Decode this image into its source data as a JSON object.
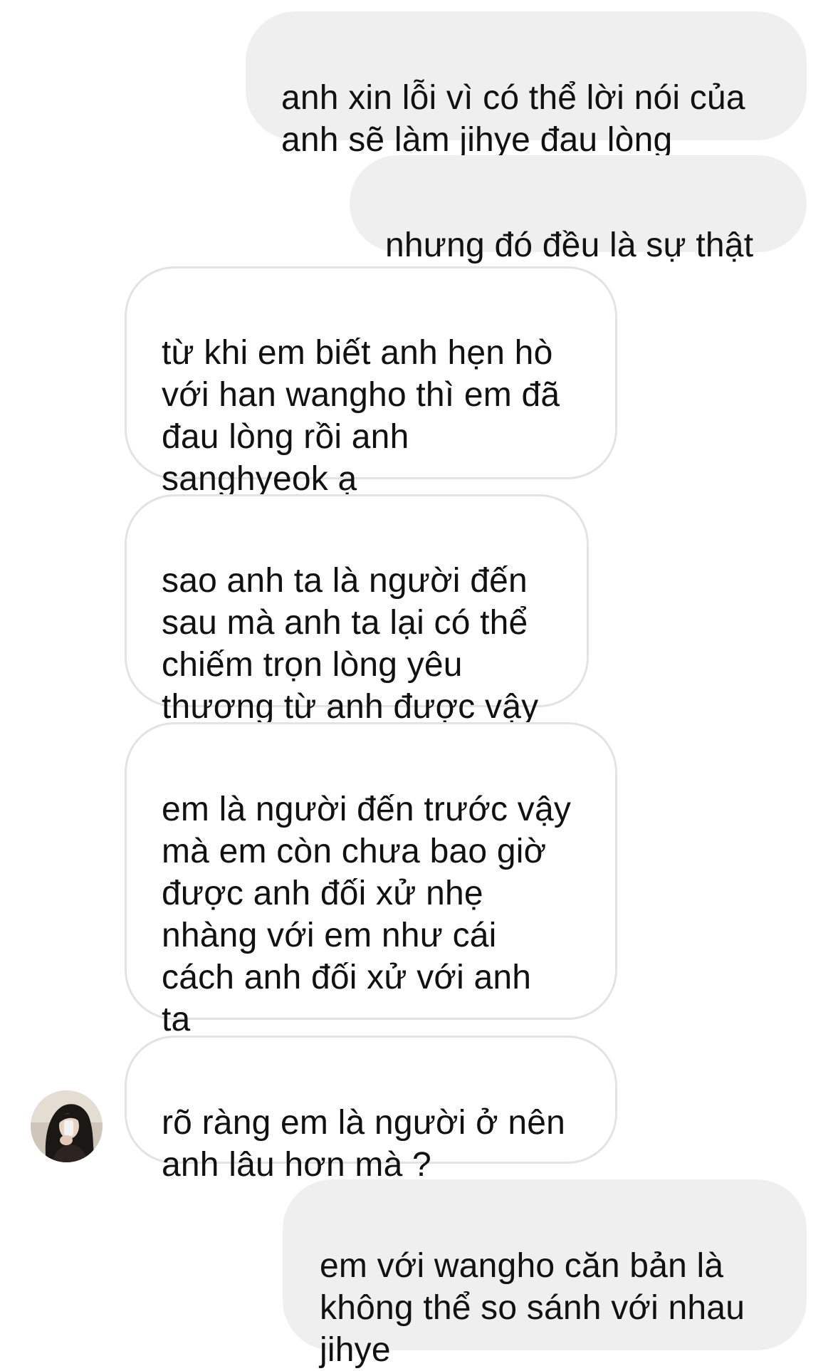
{
  "conversation": {
    "messages": [
      {
        "direction": "sent",
        "text": "anh xin lỗi vì có thể lời nói của\nanh sẽ làm jihye đau lòng"
      },
      {
        "direction": "sent",
        "text": "nhưng đó đều là sự thật"
      },
      {
        "direction": "received",
        "text": "từ khi em biết anh hẹn hò\nvới han wangho thì em đã\nđau lòng rồi anh\nsanghyeok ạ"
      },
      {
        "direction": "received",
        "text": "sao anh ta là người đến\nsau mà anh ta lại có thể\nchiếm trọn lòng yêu\nthương từ anh được vậy"
      },
      {
        "direction": "received",
        "text": "em là người đến trước vậy\nmà em còn chưa bao giờ\nđược anh đối xử nhẹ\nnhàng với em như cái\ncách anh đối xử với anh\nta"
      },
      {
        "direction": "received",
        "text": "rõ ràng em là người ở nên\nanh lâu hơn mà ?"
      },
      {
        "direction": "sent",
        "text": "em với wangho căn bản là\nkhông thể so sánh với nhau\njihye"
      }
    ],
    "avatar_icon": "contact-avatar-photo"
  },
  "colors": {
    "sent_bubble": "#efefef",
    "received_bubble": "#ffffff",
    "received_border": "#e3e3e3",
    "text": "#111111"
  }
}
